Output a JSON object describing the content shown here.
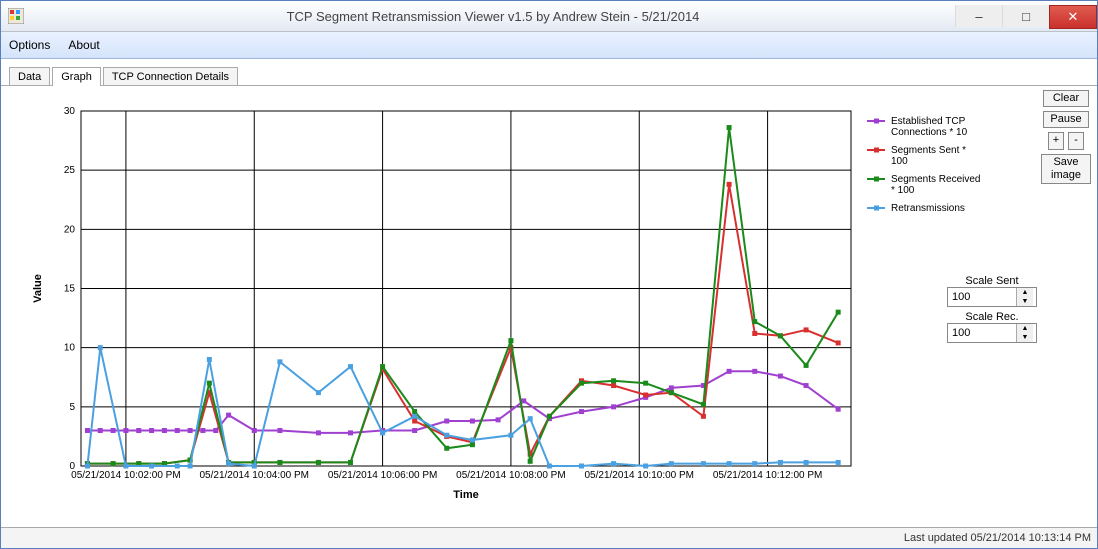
{
  "window": {
    "title": "TCP Segment Retransmission Viewer v1.5 by Andrew Stein - 5/21/2014"
  },
  "menu": {
    "options": "Options",
    "about": "About"
  },
  "tabs": {
    "data": "Data",
    "graph": "Graph",
    "details": "TCP Connection Details",
    "active": "graph"
  },
  "buttons": {
    "clear": "Clear",
    "pause": "Pause",
    "plus": "+",
    "minus": "-",
    "save": "Save image"
  },
  "scales": {
    "sent_label": "Scale Sent",
    "sent_value": "100",
    "rec_label": "Scale Rec.",
    "rec_value": "100"
  },
  "status": {
    "text": "Last updated 05/21/2014 10:13:14 PM"
  },
  "chart_data": {
    "type": "line",
    "title": "",
    "xlabel": "Time",
    "ylabel": "Value",
    "ylim": [
      0,
      30
    ],
    "yticks": [
      0,
      5,
      10,
      15,
      20,
      25,
      30
    ],
    "x_tick_labels": [
      "05/21/2014 10:02:00 PM",
      "05/21/2014 10:04:00 PM",
      "05/21/2014 10:06:00 PM",
      "05/21/2014 10:08:00 PM",
      "05/21/2014 10:10:00 PM",
      "05/21/2014 10:12:00 PM"
    ],
    "x_tick_positions": [
      2.0,
      4.0,
      6.0,
      8.0,
      10.0,
      12.0
    ],
    "x_range": [
      1.3,
      13.3
    ],
    "legend": [
      {
        "name": "Established TCP Connections * 10",
        "color": "#a040d0"
      },
      {
        "name": "Segments Sent * 100",
        "color": "#d83030"
      },
      {
        "name": "Segments Received * 100",
        "color": "#1a8a1a"
      },
      {
        "name": "Retransmissions",
        "color": "#4aa0e0"
      }
    ],
    "series": [
      {
        "name": "Established TCP Connections * 10",
        "color": "#a040d0",
        "x": [
          1.4,
          1.6,
          1.8,
          2.0,
          2.2,
          2.4,
          2.6,
          2.8,
          3.0,
          3.2,
          3.4,
          3.6,
          4.0,
          4.4,
          5.0,
          5.5,
          6.0,
          6.5,
          7.0,
          7.4,
          7.8,
          8.2,
          8.6,
          9.1,
          9.6,
          10.1,
          10.5,
          11.0,
          11.4,
          11.8,
          12.2,
          12.6,
          13.1
        ],
        "y": [
          3.0,
          3.0,
          3.0,
          3.0,
          3.0,
          3.0,
          3.0,
          3.0,
          3.0,
          3.0,
          3.0,
          4.3,
          3.0,
          3.0,
          2.8,
          2.8,
          3.0,
          3.0,
          3.8,
          3.8,
          3.9,
          5.5,
          4.0,
          4.6,
          5.0,
          5.8,
          6.6,
          6.8,
          8.0,
          8.0,
          7.6,
          6.8,
          4.8
        ]
      },
      {
        "name": "Segments Sent * 100",
        "color": "#d83030",
        "x": [
          1.4,
          1.8,
          2.2,
          2.6,
          3.0,
          3.3,
          3.6,
          4.0,
          4.4,
          5.0,
          5.5,
          6.0,
          6.5,
          7.0,
          7.4,
          8.0,
          8.3,
          8.6,
          9.1,
          9.6,
          10.1,
          10.5,
          11.0,
          11.4,
          11.8,
          12.2,
          12.6,
          13.1
        ],
        "y": [
          0.2,
          0.2,
          0.2,
          0.2,
          0.5,
          6.2,
          0.3,
          0.3,
          0.3,
          0.3,
          0.3,
          8.2,
          3.8,
          2.5,
          2.0,
          10.0,
          1.0,
          4.2,
          7.2,
          6.8,
          6.0,
          6.2,
          4.2,
          23.8,
          11.2,
          11.0,
          11.5,
          10.4
        ]
      },
      {
        "name": "Segments Received * 100",
        "color": "#1a8a1a",
        "x": [
          1.4,
          1.8,
          2.2,
          2.6,
          3.0,
          3.3,
          3.6,
          4.0,
          4.4,
          5.0,
          5.5,
          6.0,
          6.5,
          7.0,
          7.4,
          8.0,
          8.3,
          8.6,
          9.1,
          9.6,
          10.1,
          10.5,
          11.0,
          11.4,
          11.8,
          12.2,
          12.6,
          13.1
        ],
        "y": [
          0.2,
          0.2,
          0.2,
          0.2,
          0.5,
          7.0,
          0.3,
          0.3,
          0.3,
          0.3,
          0.3,
          8.4,
          4.6,
          1.5,
          1.8,
          10.6,
          0.4,
          4.2,
          7.0,
          7.2,
          7.0,
          6.2,
          5.2,
          28.6,
          12.2,
          11.0,
          8.5,
          13.0
        ]
      },
      {
        "name": "Retransmissions",
        "color": "#4aa0e0",
        "x": [
          1.4,
          1.6,
          2.0,
          2.4,
          2.8,
          3.0,
          3.3,
          3.6,
          4.0,
          4.4,
          5.0,
          5.5,
          6.0,
          6.5,
          7.0,
          7.4,
          8.0,
          8.3,
          8.6,
          9.1,
          9.6,
          10.1,
          10.5,
          11.0,
          11.4,
          11.8,
          12.2,
          12.6,
          13.1
        ],
        "y": [
          0.0,
          10.0,
          0.0,
          0.0,
          0.0,
          0.0,
          9.0,
          0.2,
          0.0,
          8.8,
          6.2,
          8.4,
          2.8,
          4.2,
          2.6,
          2.2,
          2.6,
          4.0,
          0.0,
          0.0,
          0.2,
          0.0,
          0.2,
          0.2,
          0.2,
          0.2,
          0.3,
          0.3,
          0.3
        ]
      }
    ]
  }
}
